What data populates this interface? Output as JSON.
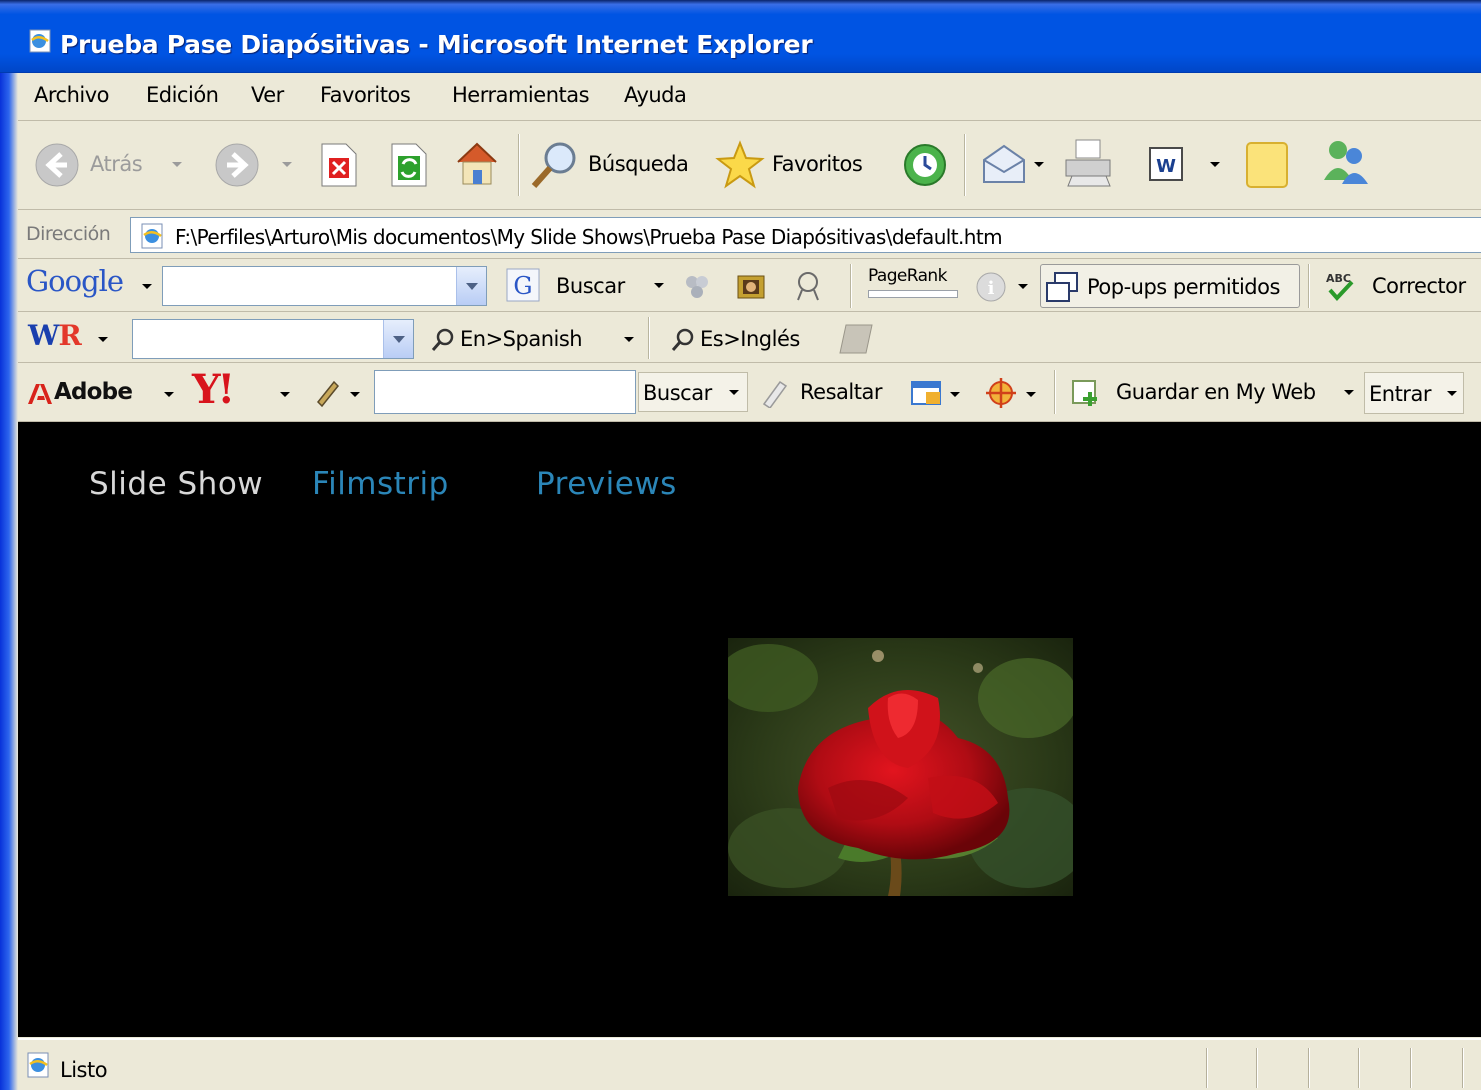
{
  "window": {
    "title": "Prueba Pase Diapósitivas - Microsoft Internet Explorer"
  },
  "menu": [
    "Archivo",
    "Edición",
    "Ver",
    "Favoritos",
    "Herramientas",
    "Ayuda"
  ],
  "toolbar": {
    "back_label": "Atrás",
    "search_label": "Búsqueda",
    "favorites_label": "Favoritos"
  },
  "address": {
    "label": "Dirección",
    "url": "F:\\Perfiles\\Arturo\\Mis documentos\\My Slide Shows\\Prueba  Pase Diapósitivas\\default.htm"
  },
  "google_bar": {
    "logo": "Google",
    "search_label": "Buscar",
    "pagerank_label": "PageRank",
    "popups_label": "Pop-ups permitidos",
    "spell_label": "Corrector"
  },
  "wr_bar": {
    "logo": "WR",
    "en_spanish": "En>Spanish",
    "es_ingles": "Es>Inglés"
  },
  "yahoo_bar": {
    "adobe_label": "Adobe",
    "yahoo_logo": "Y!",
    "search_label": "Buscar",
    "highlight_label": "Resaltar",
    "save_label": "Guardar en My Web",
    "enter_label": "Entrar"
  },
  "page": {
    "nav": {
      "slideshow": "Slide Show",
      "filmstrip": "Filmstrip",
      "previews": "Previews"
    },
    "colors": {
      "active_link": "#d8d8d8",
      "inactive_link": "#2b86b8",
      "background": "#000000"
    },
    "photo_subject": "red-rose-photo"
  },
  "status": {
    "text": "Listo"
  }
}
